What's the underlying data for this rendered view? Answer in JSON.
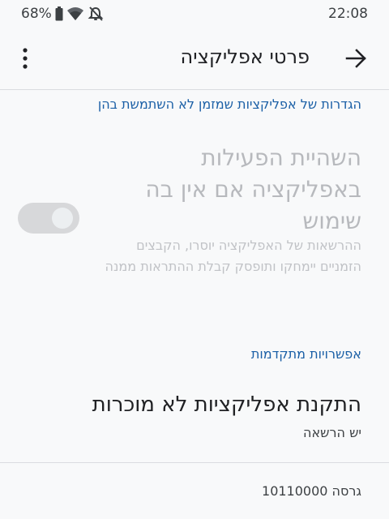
{
  "status": {
    "battery": "68%",
    "time": "22:08",
    "icons": [
      "battery-icon",
      "wifi-icon",
      "bell-off-icon"
    ]
  },
  "app_bar": {
    "title": "פרטי אפליקציה",
    "icons": [
      "arrow-right-icon",
      "more-vert-icon"
    ]
  },
  "sections": {
    "unused_apps_header": "הגדרות של אפליקציות שמזמן לא השתמשת בהן",
    "advanced_header": "אפשרויות מתקדמות"
  },
  "pause_activity": {
    "title": "השהיית הפעילות באפליקציה אם אין בה שימוש",
    "description": "ההרשאות של האפליקציה יוסרו, הקבצים הזמניים יימחקו ותופסק קבלת ההתראות ממנה",
    "enabled": false,
    "toggle_on": true
  },
  "unknown_apps": {
    "title": "התקנת אפליקציות לא מוכרות",
    "subtitle": "יש הרשאה"
  },
  "version": "גרסה 10110000",
  "colors": {
    "background": "#f8f9fa",
    "accent": "#1a5fa6",
    "disabled_text": "#b7b9bd",
    "toggle_track": "#d7d8da"
  }
}
